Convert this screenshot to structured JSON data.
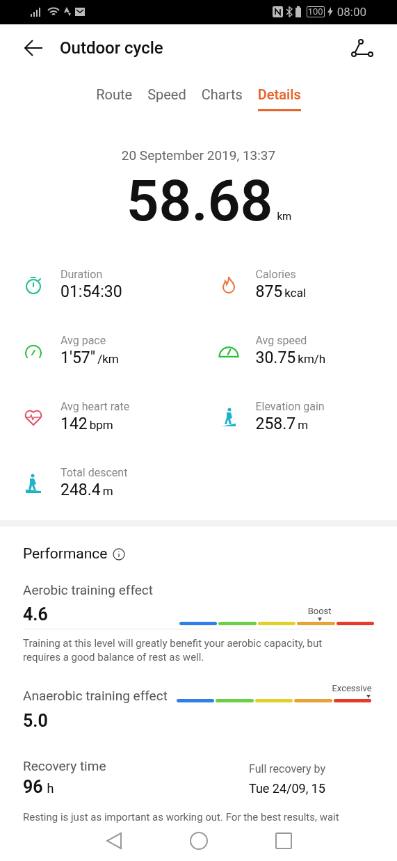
{
  "status_bar": {
    "battery": "100",
    "time": "08:00"
  },
  "header": {
    "title": "Outdoor cycle"
  },
  "tabs": [
    {
      "label": "Route",
      "selected": false
    },
    {
      "label": "Speed",
      "selected": false
    },
    {
      "label": "Charts",
      "selected": false
    },
    {
      "label": "Details",
      "selected": true
    }
  ],
  "summary": {
    "date": "20 September 2019, 13:37",
    "distance": "58.68",
    "unit": "km"
  },
  "metrics": [
    {
      "kind": "stopwatch",
      "label": "Duration",
      "value": "01:54:30"
    },
    {
      "kind": "flame",
      "label": "Calories",
      "value": "875",
      "unit": "kcal"
    },
    {
      "kind": "pace",
      "label": "Avg pace",
      "value": "1'57\"",
      "unit": "/km"
    },
    {
      "kind": "speedometer",
      "label": "Avg speed",
      "value": "30.75",
      "unit": "km/h"
    },
    {
      "kind": "heart",
      "label": "Avg heart rate",
      "value": "142",
      "unit": "bpm"
    },
    {
      "kind": "climb",
      "label": "Elevation gain",
      "value": "258.7",
      "unit": "m"
    },
    {
      "kind": "descent",
      "label": "Total descent",
      "value": "248.4",
      "unit": "m"
    }
  ],
  "performance": {
    "title": "Performance",
    "aerobic": {
      "label": "Aerobic training effect",
      "value": "4.6",
      "marker": "Boost",
      "level": 0.72,
      "description": "Training at this level will greatly benefit your aerobic capacity, but requires a good balance of rest as well."
    },
    "anaerobic": {
      "label": "Anaerobic training effect",
      "value": "5.0",
      "marker": "Excessive",
      "level": 0.985
    },
    "recovery": {
      "label": "Recovery time",
      "value": "96",
      "unit": "h",
      "full_label": "Full recovery by",
      "full_value": "Tue 24/09, 15",
      "note": "Resting is just as important as working out. For the best results, wait"
    }
  }
}
